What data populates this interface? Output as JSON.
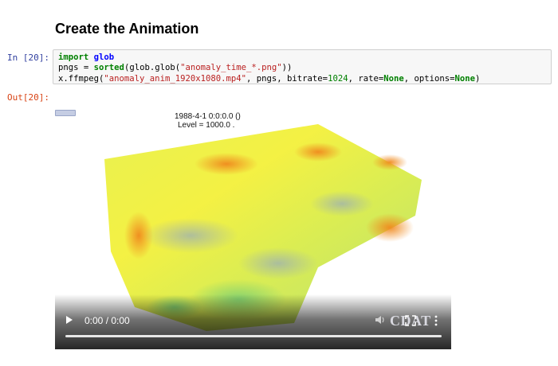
{
  "heading": "Create the Animation",
  "cell_in": {
    "prompt": "In [20]:",
    "lines": [
      [
        {
          "t": "import",
          "c": "kw"
        },
        {
          "t": " "
        },
        {
          "t": "glob",
          "c": "mod"
        }
      ],
      [
        {
          "t": "pngs = "
        },
        {
          "t": "sorted",
          "c": "kw2"
        },
        {
          "t": "(glob.glob("
        },
        {
          "t": "\"anomaly_time_*.png\"",
          "c": "str"
        },
        {
          "t": "))"
        }
      ],
      [
        {
          "t": "x.ffmpeg("
        },
        {
          "t": "\"anomaly_anim_1920x1080.mp4\"",
          "c": "str"
        },
        {
          "t": ", pngs, bitrate="
        },
        {
          "t": "1024",
          "c": "num"
        },
        {
          "t": ", rate="
        },
        {
          "t": "None",
          "c": "kw"
        },
        {
          "t": ", options="
        },
        {
          "t": "None",
          "c": "kw"
        },
        {
          "t": ")"
        }
      ]
    ]
  },
  "cell_out": {
    "prompt": "Out[20]:"
  },
  "video": {
    "overlay_line1": "1988-4-1 0:0:0.0 ()",
    "overlay_line2": "Level = 1000.0 .",
    "time_display": "0:00 / 0:00",
    "progress": 0,
    "logo_text": "CDAT"
  },
  "colors": {
    "keyword": "#008000",
    "string": "#ba2121",
    "module": "#0000ff",
    "in_prompt": "#303f9f",
    "out_prompt": "#d84315"
  }
}
